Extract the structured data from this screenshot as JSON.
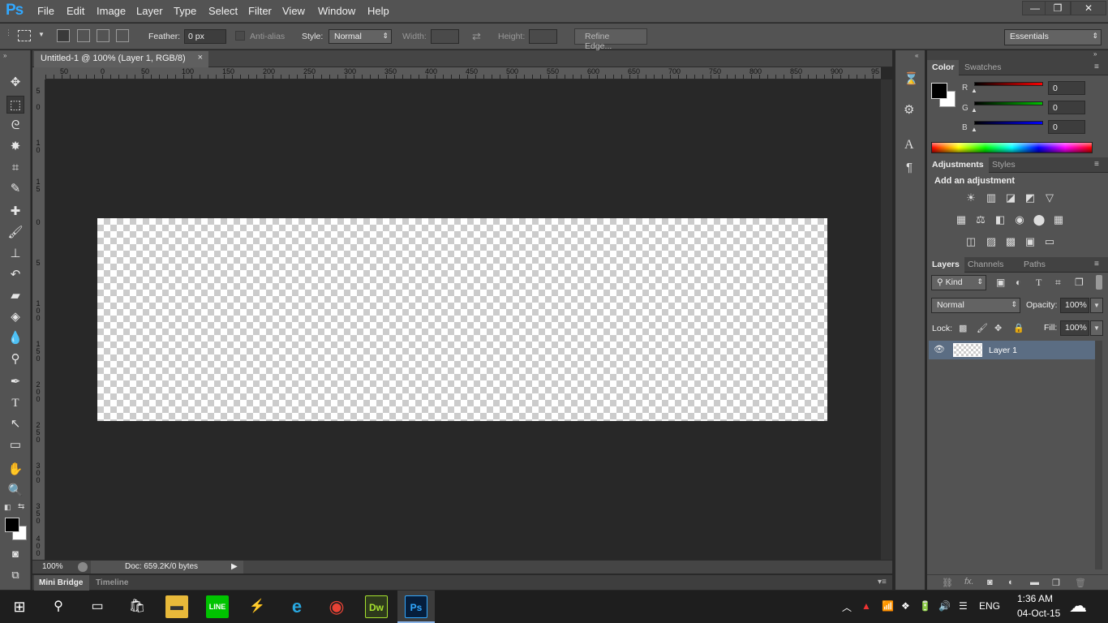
{
  "app": {
    "logo": "Ps"
  },
  "menu": [
    "File",
    "Edit",
    "Image",
    "Layer",
    "Type",
    "Select",
    "Filter",
    "View",
    "Window",
    "Help"
  ],
  "window_controls": {
    "minimize": "—",
    "restore": "❐",
    "close": "✕"
  },
  "options": {
    "feather_label": "Feather:",
    "feather_value": "0 px",
    "antialias_label": "Anti-alias",
    "style_label": "Style:",
    "style_value": "Normal",
    "width_label": "Width:",
    "height_label": "Height:",
    "refine_edge": "Refine Edge...",
    "workspace": "Essentials"
  },
  "document": {
    "tab_title": "Untitled-1 @ 100% (Layer 1, RGB/8)",
    "tab_close": "×",
    "zoom": "100%",
    "doc_info": "Doc: 659.2K/0 bytes"
  },
  "ruler_top": [
    "50",
    "0",
    "50",
    "100",
    "150",
    "200",
    "250",
    "300",
    "350",
    "400",
    "450",
    "500",
    "550",
    "600",
    "650",
    "700",
    "750",
    "800",
    "850",
    "900",
    "95"
  ],
  "ruler_left": [
    "5",
    "0",
    "1\n0",
    "1\n5",
    "0",
    "5",
    "1\n0\n0",
    "1\n5\n0",
    "2\n0\n0",
    "2\n5\n0",
    "3\n0\n0",
    "3\n5\n0",
    "4\n0\n0"
  ],
  "bottom_tabs": {
    "mini_bridge": "Mini Bridge",
    "timeline": "Timeline"
  },
  "color_panel": {
    "tabs": [
      "Color",
      "Swatches"
    ],
    "r_label": "R",
    "g_label": "G",
    "b_label": "B",
    "r": "0",
    "g": "0",
    "b": "0",
    "colors": {
      "r_track": "#ff0000",
      "g_track": "#00c000",
      "b_track": "#0000ff"
    }
  },
  "adjustments_panel": {
    "tabs": [
      "Adjustments",
      "Styles"
    ],
    "heading": "Add an adjustment"
  },
  "layers_panel": {
    "tabs": [
      "Layers",
      "Channels",
      "Paths"
    ],
    "kind": "Kind",
    "blend_mode": "Normal",
    "opacity_label": "Opacity:",
    "opacity": "100%",
    "lock_label": "Lock:",
    "fill_label": "Fill:",
    "fill": "100%",
    "layers": [
      {
        "name": "Layer 1",
        "visible": true,
        "selected": true
      }
    ]
  },
  "taskbar": {
    "time": "1:36 AM",
    "date": "04-Oct-15",
    "lang": "ENG",
    "apps": [
      "windows-start",
      "search",
      "task-view",
      "store",
      "file-explorer",
      "line",
      "winamp",
      "internet-explorer",
      "chrome",
      "dreamweaver",
      "photoshop"
    ]
  }
}
